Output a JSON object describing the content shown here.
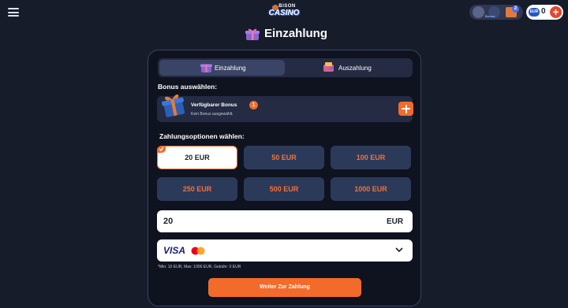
{
  "header": {
    "menu_icon": "hamburger-icon",
    "logo": {
      "top": "BISON",
      "bottom": "CASINO"
    },
    "promos": {
      "label": "Bonus",
      "badge": "2"
    },
    "wallet": {
      "currency": "EUR",
      "balance": "0",
      "add_icon": "plus-icon"
    }
  },
  "page": {
    "title": "Einzahlung",
    "title_icon": "gift-icon"
  },
  "tabs": [
    {
      "label": "Einzahlung",
      "active": true
    },
    {
      "label": "Auszahlung",
      "active": false
    }
  ],
  "bonus": {
    "section_label": "Bonus auswählen:",
    "title": "Verfügbarer Bonus",
    "count": "1",
    "subtitle": "Kein Bonus ausgewählt."
  },
  "payment": {
    "section_label": "Zahlungsoptionen wählen:",
    "amounts": [
      "20 EUR",
      "50 EUR",
      "100 EUR",
      "250 EUR",
      "500 EUR",
      "1000 EUR"
    ],
    "selected_amount": "20 EUR",
    "input_value": "20",
    "currency": "EUR",
    "method_label": "VISA",
    "limits": "*Min: 10 EUR, Max: 1000 EUR, Gebühr: 0 EUR",
    "submit_label": "Weiter Zur Zahlung"
  },
  "colors": {
    "background": "#171c2b",
    "card": "#0f1320",
    "accent": "#f26b2b",
    "amount_button": "#2c3a5a"
  }
}
